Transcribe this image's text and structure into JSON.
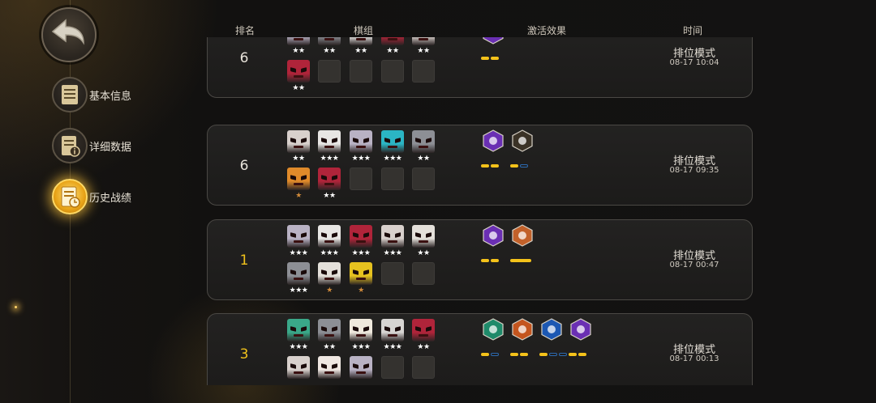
{
  "nav": {
    "back_icon": "back-arrow-icon",
    "items": [
      {
        "label": "基本信息",
        "icon": "notebook-icon",
        "active": false
      },
      {
        "label": "详细数据",
        "icon": "info-document-icon",
        "active": false
      },
      {
        "label": "历史战绩",
        "icon": "history-document-icon",
        "active": true
      }
    ]
  },
  "table": {
    "headers": {
      "rank": "排名",
      "lineup": "棋组",
      "synergy": "激活效果",
      "time": "时间"
    },
    "rows": [
      {
        "rank": "6",
        "mode": "排位模式",
        "time": "08-17 10:04",
        "units": [
          {
            "icon": "white-cat-knight-icon",
            "stars": "★★",
            "color": "#b9b2c4"
          },
          {
            "icon": "grey-helm-warrior-icon",
            "stars": "★★",
            "color": "#8d8f95"
          },
          {
            "icon": "white-masked-ogre-icon",
            "stars": "★★",
            "color": "#e8e6e4"
          },
          {
            "icon": "red-demon-icon",
            "stars": "★★",
            "color": "#b0243a"
          },
          {
            "icon": "white-horned-demon-icon",
            "stars": "★★",
            "color": "#d8d0cc"
          },
          {
            "icon": "red-demon-icon",
            "stars": "★★",
            "color": "#b0243a"
          },
          {
            "icon": "empty-slot",
            "stars": "",
            "color": ""
          },
          {
            "icon": "empty-slot",
            "stars": "",
            "color": ""
          },
          {
            "icon": "empty-slot",
            "stars": "",
            "color": ""
          },
          {
            "icon": "empty-slot",
            "stars": "",
            "color": ""
          }
        ],
        "synergies": [
          {
            "icon": "purple-demon-hex-icon",
            "color": "#6a2fb3",
            "bars": [
              "on",
              "on"
            ]
          }
        ]
      },
      {
        "rank": "6",
        "mode": "排位模式",
        "time": "08-17 09:35",
        "units": [
          {
            "icon": "white-horned-demon-icon",
            "stars": "★★",
            "color": "#d8d0cc"
          },
          {
            "icon": "white-masked-ogre-icon",
            "stars": "★★★",
            "color": "#e8e6e4"
          },
          {
            "icon": "white-cat-knight-icon",
            "stars": "★★★",
            "color": "#b9b2c4"
          },
          {
            "icon": "cyan-goblin-mech-icon",
            "stars": "★★★",
            "color": "#2bb5c4"
          },
          {
            "icon": "grey-helm-warrior-icon",
            "stars": "★★",
            "color": "#8d8f95"
          },
          {
            "icon": "orange-beast-icon",
            "stars": "★",
            "starStyle": "bronze",
            "color": "#e08a2a"
          },
          {
            "icon": "red-demon-icon",
            "stars": "★★",
            "color": "#b0243a"
          },
          {
            "icon": "empty-slot",
            "stars": "",
            "color": ""
          },
          {
            "icon": "empty-slot",
            "stars": "",
            "color": ""
          },
          {
            "icon": "empty-slot",
            "stars": "",
            "color": ""
          }
        ],
        "synergies": [
          {
            "icon": "purple-demon-hex-icon",
            "color": "#6a2fb3",
            "bars": [
              "on",
              "on"
            ]
          },
          {
            "icon": "claw-hunter-hex-icon",
            "color": "#3a3226",
            "bars": [
              "on",
              "off"
            ]
          }
        ]
      },
      {
        "rank": "1",
        "rankStyle": "gold",
        "mode": "排位模式",
        "time": "08-17 00:47",
        "units": [
          {
            "icon": "white-cat-knight-icon",
            "stars": "★★★",
            "color": "#b9b2c4"
          },
          {
            "icon": "white-masked-ogre-icon",
            "stars": "★★★",
            "color": "#e8e6e4"
          },
          {
            "icon": "red-demon-icon",
            "stars": "★★★",
            "color": "#b0243a"
          },
          {
            "icon": "white-horned-demon-icon",
            "stars": "★★★",
            "color": "#d8d0cc"
          },
          {
            "icon": "skull-mask-icon",
            "stars": "★★",
            "color": "#e4e0da"
          },
          {
            "icon": "grey-helm-warrior-icon",
            "stars": "★★★",
            "color": "#8d8f95"
          },
          {
            "icon": "skull-mask-icon",
            "stars": "★",
            "starStyle": "bronze",
            "color": "#e4e0da"
          },
          {
            "icon": "gold-robot-icon",
            "stars": "★",
            "starStyle": "bronze",
            "color": "#e6c21f"
          },
          {
            "icon": "empty-slot",
            "stars": "",
            "color": ""
          },
          {
            "icon": "empty-slot",
            "stars": "",
            "color": ""
          }
        ],
        "synergies": [
          {
            "icon": "purple-demon-hex-icon",
            "color": "#6a2fb3",
            "bars": [
              "on",
              "on"
            ]
          },
          {
            "icon": "orange-beast-circle-icon",
            "color": "#c2612a",
            "bars": [
              "on"
            ]
          }
        ]
      },
      {
        "rank": "3",
        "rankStyle": "gold",
        "mode": "排位模式",
        "time": "08-17 00:13",
        "units": [
          {
            "icon": "green-dragon-icon",
            "stars": "★★★",
            "color": "#3aa889"
          },
          {
            "icon": "grey-helm-warrior-icon",
            "stars": "★★",
            "color": "#8d8f95"
          },
          {
            "icon": "white-cowboy-icon",
            "stars": "★★★",
            "color": "#efe9dd"
          },
          {
            "icon": "white-silver-hair-icon",
            "stars": "★★★",
            "color": "#d7d5d2"
          },
          {
            "icon": "red-demon-icon",
            "stars": "★★",
            "color": "#b0243a"
          },
          {
            "icon": "white-horned-demon-icon",
            "stars": "",
            "color": "#d8d0cc"
          },
          {
            "icon": "white-bird-icon",
            "stars": "",
            "color": "#efe7e2"
          },
          {
            "icon": "white-cat-knight-icon",
            "stars": "",
            "color": "#b9b2c4"
          },
          {
            "icon": "empty-slot",
            "stars": "",
            "color": ""
          },
          {
            "icon": "empty-slot",
            "stars": "",
            "color": ""
          }
        ],
        "synergies": [
          {
            "icon": "green-paw-hex-icon",
            "color": "#1f8a6a",
            "bars": [
              "on",
              "off"
            ]
          },
          {
            "icon": "orange-feather-hex-icon",
            "color": "#c4551e",
            "bars": [
              "on",
              "on"
            ]
          },
          {
            "icon": "blue-feather-hex-icon",
            "color": "#1c58b3",
            "bars": [
              "on",
              "off",
              "off"
            ]
          },
          {
            "icon": "purple-demon-hex-icon",
            "color": "#6a2fb3",
            "bars": [
              "on",
              "on"
            ]
          }
        ]
      }
    ]
  }
}
